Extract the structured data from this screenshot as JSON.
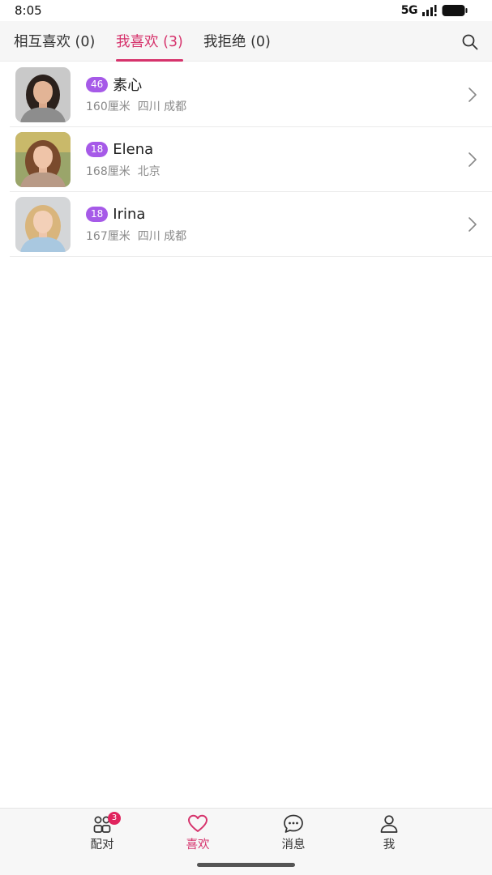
{
  "status_bar": {
    "time": "8:05",
    "network": "5G",
    "icons": [
      "signal-icon",
      "battery-icon"
    ]
  },
  "tabs": [
    {
      "label": "相互喜欢 (0)",
      "active": false
    },
    {
      "label": "我喜欢 (3)",
      "active": true
    },
    {
      "label": "我拒绝 (0)",
      "active": false
    }
  ],
  "search_icon": "search-icon",
  "profiles": [
    {
      "age": "46",
      "name": "素心",
      "height": "160厘米",
      "location": "四川 成都",
      "hair_color": "#2b211c",
      "shirt_color": "#8d8d8d"
    },
    {
      "age": "18",
      "name": "Elena",
      "height": "168厘米",
      "location": "北京",
      "hair_color": "#7a4a2c",
      "shirt_color": "#b89a86"
    },
    {
      "age": "18",
      "name": "Irina",
      "height": "167厘米",
      "location": "四川 成都",
      "hair_color": "#d9b57c",
      "shirt_color": "#a9c8e0"
    }
  ],
  "bottom_nav": [
    {
      "label": "配对",
      "icon": "match-users-icon",
      "badge": "3",
      "active": false
    },
    {
      "label": "喜欢",
      "icon": "heart-icon",
      "active": true
    },
    {
      "label": "消息",
      "icon": "chat-bubble-icon",
      "active": false
    },
    {
      "label": "我",
      "icon": "person-icon",
      "active": false
    }
  ],
  "colors": {
    "accent": "#d6336c",
    "age_badge": "#a65ae8",
    "nav_badge": "#e0245e"
  }
}
